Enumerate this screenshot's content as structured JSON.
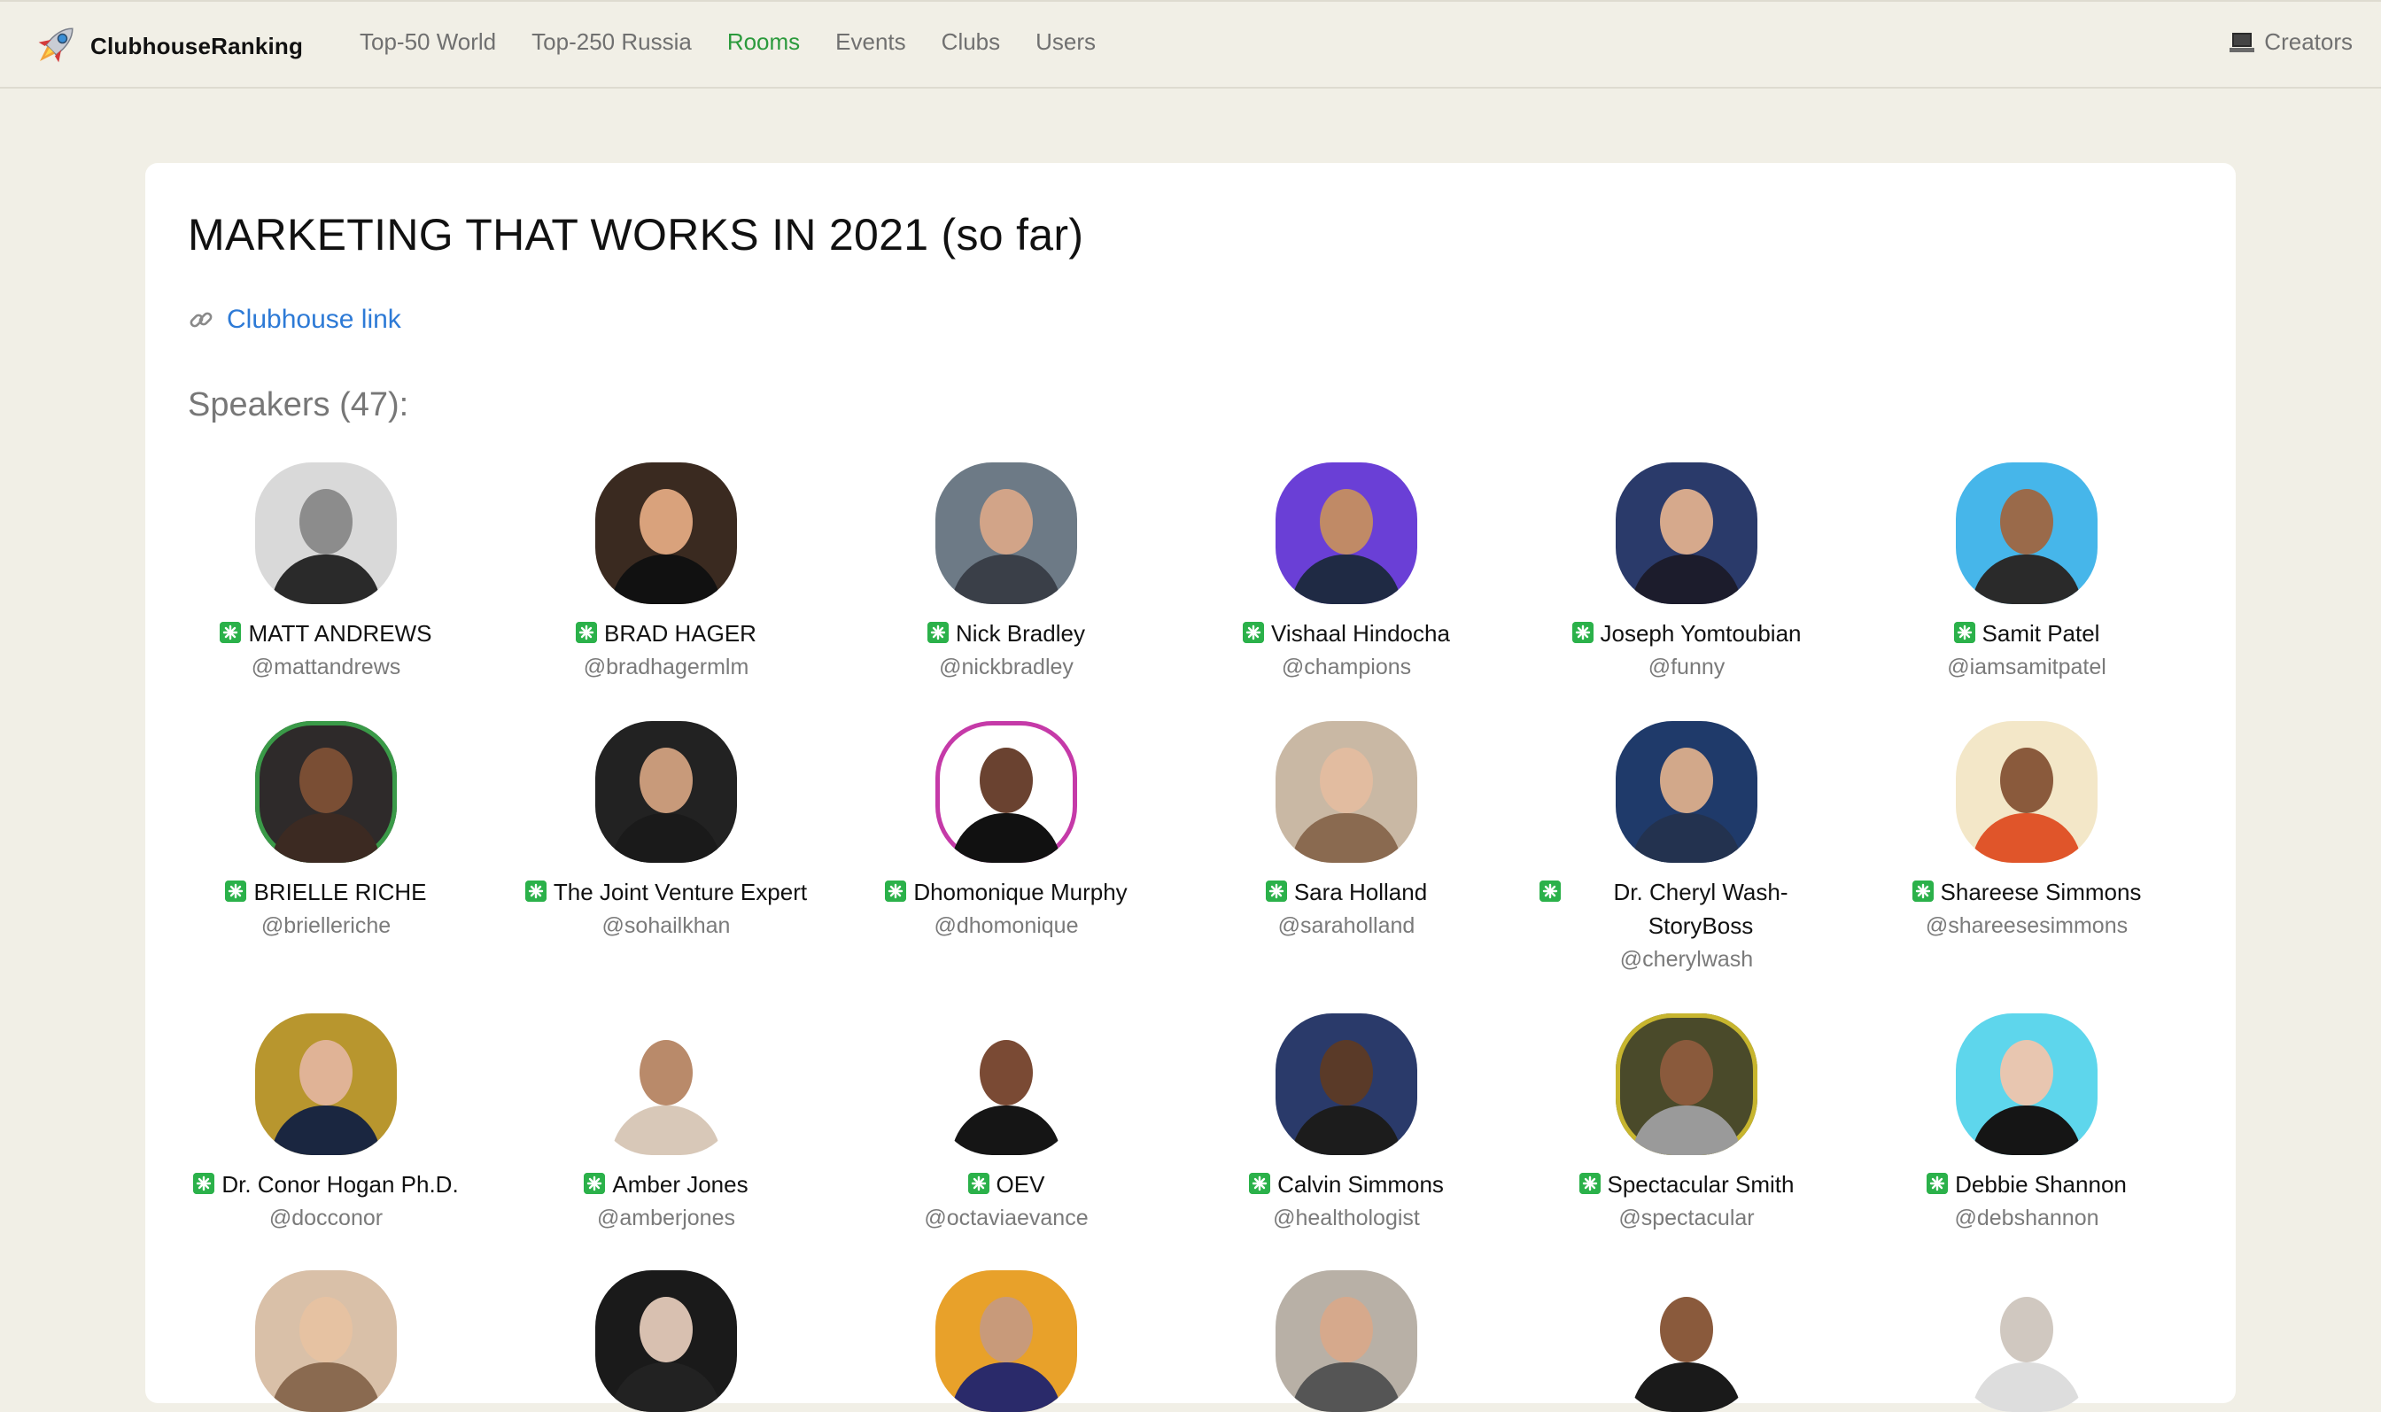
{
  "nav": {
    "brand": "ClubhouseRanking",
    "links": [
      {
        "label": "Top-50 World",
        "active": false
      },
      {
        "label": "Top-250 Russia",
        "active": false
      },
      {
        "label": "Rooms",
        "active": true
      },
      {
        "label": "Events",
        "active": false
      },
      {
        "label": "Clubs",
        "active": false
      },
      {
        "label": "Users",
        "active": false
      }
    ],
    "creators": "Creators"
  },
  "room": {
    "title": "MARKETING THAT WORKS IN 2021 (so far)",
    "link_label": "Clubhouse link",
    "speakers_heading": "Speakers (47):"
  },
  "colors": {
    "page_bg": "#f1efe6",
    "card_bg": "#ffffff",
    "nav_active": "#2b9a3c",
    "link": "#2d7ad6",
    "badge": "#2bb14a"
  },
  "speakers": [
    {
      "name": "MATT ANDREWS",
      "handle": "@mattandrews",
      "bg": "#d9d9d9",
      "skin": "#8c8c8c",
      "cloth": "#2a2a2a",
      "ring": ""
    },
    {
      "name": "BRAD HAGER",
      "handle": "@bradhagermlm",
      "bg": "#3a2a20",
      "skin": "#d9a27c",
      "cloth": "#111111",
      "ring": ""
    },
    {
      "name": "Nick Bradley",
      "handle": "@nickbradley",
      "bg": "#6d7a86",
      "skin": "#d2a488",
      "cloth": "#3a3f48",
      "ring": ""
    },
    {
      "name": "Vishaal Hindocha",
      "handle": "@champions",
      "bg": "#6a3fd6",
      "skin": "#c08a66",
      "cloth": "#1f2a44",
      "ring": ""
    },
    {
      "name": "Joseph Yomtoubian",
      "handle": "@funny",
      "bg": "#2a3a6a",
      "skin": "#d6a98c",
      "cloth": "#1c1c2c",
      "ring": ""
    },
    {
      "name": "Samit Patel",
      "handle": "@iamsamitpatel",
      "bg": "#46b6ea",
      "skin": "#9a6a4a",
      "cloth": "#2a2a2a",
      "ring": ""
    },
    {
      "name": "BRIELLE RICHE",
      "handle": "@brielleriche",
      "bg": "#2e2a2a",
      "skin": "#7a4e34",
      "cloth": "#3c2a22",
      "ring": "#3a9a48"
    },
    {
      "name": "The Joint Venture Expert",
      "handle": "@sohailkhan",
      "bg": "#222222",
      "skin": "#c89a7a",
      "cloth": "#1a1a1a",
      "ring": ""
    },
    {
      "name": "Dhomonique Murphy",
      "handle": "@dhomonique",
      "bg": "#ffffff",
      "skin": "#6a4230",
      "cloth": "#111111",
      "ring": "#c53aa8"
    },
    {
      "name": "Sara Holland",
      "handle": "@saraholland",
      "bg": "#c9b8a4",
      "skin": "#e2bca0",
      "cloth": "#8a6a50",
      "ring": ""
    },
    {
      "name": "Dr. Cheryl Wash-StoryBoss",
      "handle": "@cherylwash",
      "bg": "#1f3a6a",
      "skin": "#d2a88a",
      "cloth": "#23324f",
      "ring": ""
    },
    {
      "name": "Shareese Simmons",
      "handle": "@shareesesimmons",
      "bg": "#f3e7c8",
      "skin": "#8a5a3c",
      "cloth": "#e0552a",
      "ring": ""
    },
    {
      "name": "Dr. Conor Hogan Ph.D.",
      "handle": "@docconor",
      "bg": "#b8962e",
      "skin": "#e0b396",
      "cloth": "#1a2640",
      "ring": ""
    },
    {
      "name": "Amber Jones",
      "handle": "@amberjones",
      "bg": "#ffffff",
      "skin": "#b98a6a",
      "cloth": "#d8c8b8",
      "ring": ""
    },
    {
      "name": "OEV",
      "handle": "@octaviaevance",
      "bg": "#ffffff",
      "skin": "#7a4a34",
      "cloth": "#151515",
      "ring": ""
    },
    {
      "name": "Calvin Simmons",
      "handle": "@healthologist",
      "bg": "#2a3a6a",
      "skin": "#5a3a28",
      "cloth": "#1c1c1c",
      "ring": ""
    },
    {
      "name": "Spectacular Smith",
      "handle": "@spectacular",
      "bg": "#4a4a2a",
      "skin": "#8a5a3c",
      "cloth": "#9a9a9a",
      "ring": "#c7b52e"
    },
    {
      "name": "Debbie Shannon",
      "handle": "@debshannon",
      "bg": "#5ed6ec",
      "skin": "#e8c6b0",
      "cloth": "#151515",
      "ring": ""
    },
    {
      "name": "",
      "handle": "",
      "bg": "#d9c0a8",
      "skin": "#e6c2a2",
      "cloth": "#8a6a50",
      "ring": ""
    },
    {
      "name": "",
      "handle": "",
      "bg": "#1a1a1a",
      "skin": "#d8c0b0",
      "cloth": "#222222",
      "ring": ""
    },
    {
      "name": "",
      "handle": "",
      "bg": "#e8a12a",
      "skin": "#c89a7a",
      "cloth": "#2a2a6a",
      "ring": ""
    },
    {
      "name": "",
      "handle": "",
      "bg": "#b8b0a6",
      "skin": "#d6a98c",
      "cloth": "#555555",
      "ring": ""
    },
    {
      "name": "",
      "handle": "",
      "bg": "#ffffff",
      "skin": "#8a5a3c",
      "cloth": "#1a1a1a",
      "ring": ""
    },
    {
      "name": "",
      "handle": "",
      "bg": "#ffffff",
      "skin": "#d0c8c0",
      "cloth": "#dddddd",
      "ring": ""
    }
  ]
}
